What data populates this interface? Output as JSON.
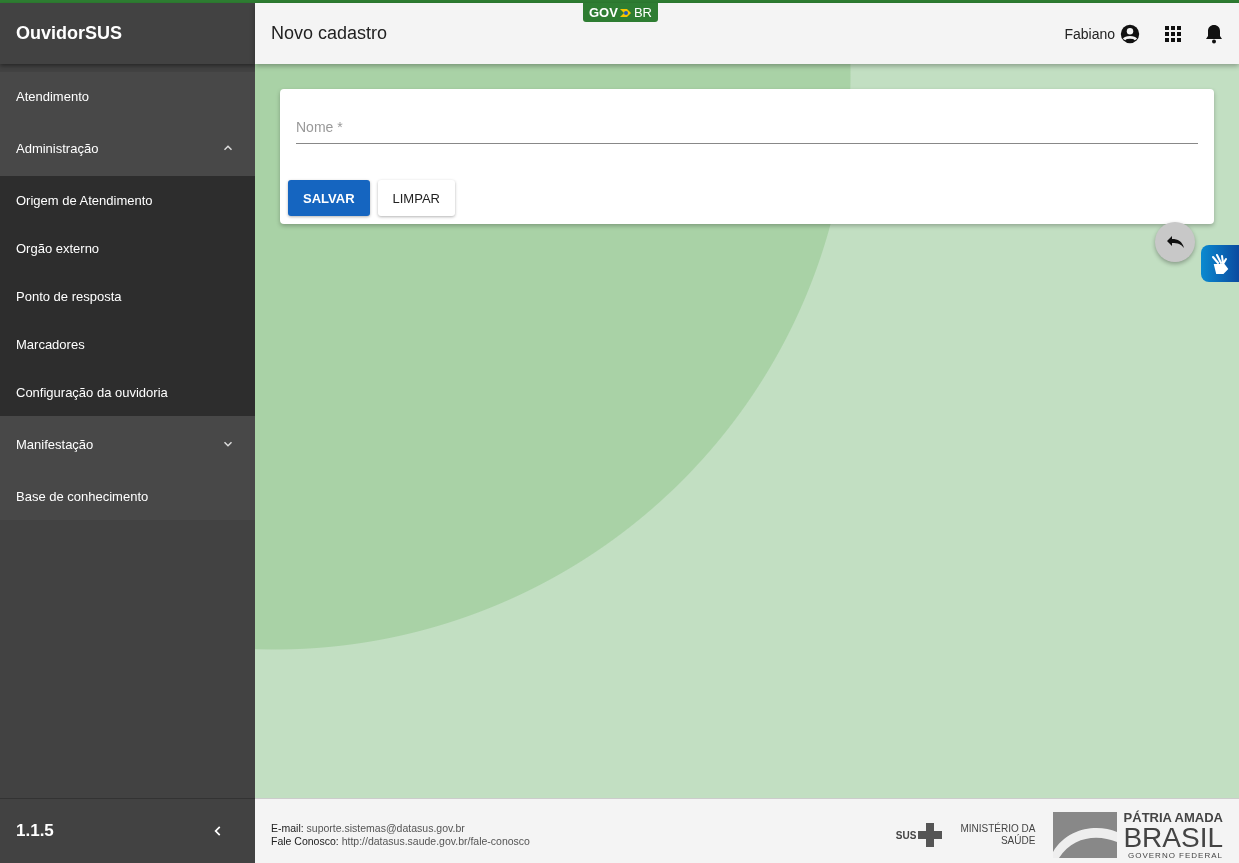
{
  "gov_badge": {
    "left": "GOV",
    "right": "BR"
  },
  "sidebar": {
    "title": "OuvidorSUS",
    "items": [
      {
        "label": "Atendimento"
      },
      {
        "label": "Administração",
        "expanded": true,
        "children": [
          {
            "label": "Origem de Atendimento"
          },
          {
            "label": "Orgão externo"
          },
          {
            "label": "Ponto de resposta"
          },
          {
            "label": "Marcadores"
          },
          {
            "label": "Configuração da ouvidoria"
          }
        ]
      },
      {
        "label": "Manifestação",
        "expanded": false
      },
      {
        "label": "Base de conhecimento"
      }
    ],
    "version": "1.1.5"
  },
  "header": {
    "title": "Novo cadastro",
    "user": "Fabiano"
  },
  "form": {
    "fields": [
      {
        "placeholder": "Nome *"
      }
    ],
    "buttons": [
      {
        "label": "SALVAR",
        "kind": "primary"
      },
      {
        "label": "LIMPAR",
        "kind": "secondary"
      }
    ]
  },
  "footer": {
    "lines": [
      {
        "label": "E-mail:",
        "value": "suporte.sistemas@datasus.gov.br"
      },
      {
        "label": "Fale Conosco:",
        "value": "http://datasus.saude.gov.br/fale-conosco"
      }
    ],
    "sus": "SUS",
    "ministry": [
      "MINISTÉRIO DA",
      "SAÚDE"
    ],
    "brand": {
      "line1": "PÁTRIA AMADA",
      "line2": "BRASIL",
      "line3": "GOVERNO FEDERAL"
    }
  }
}
